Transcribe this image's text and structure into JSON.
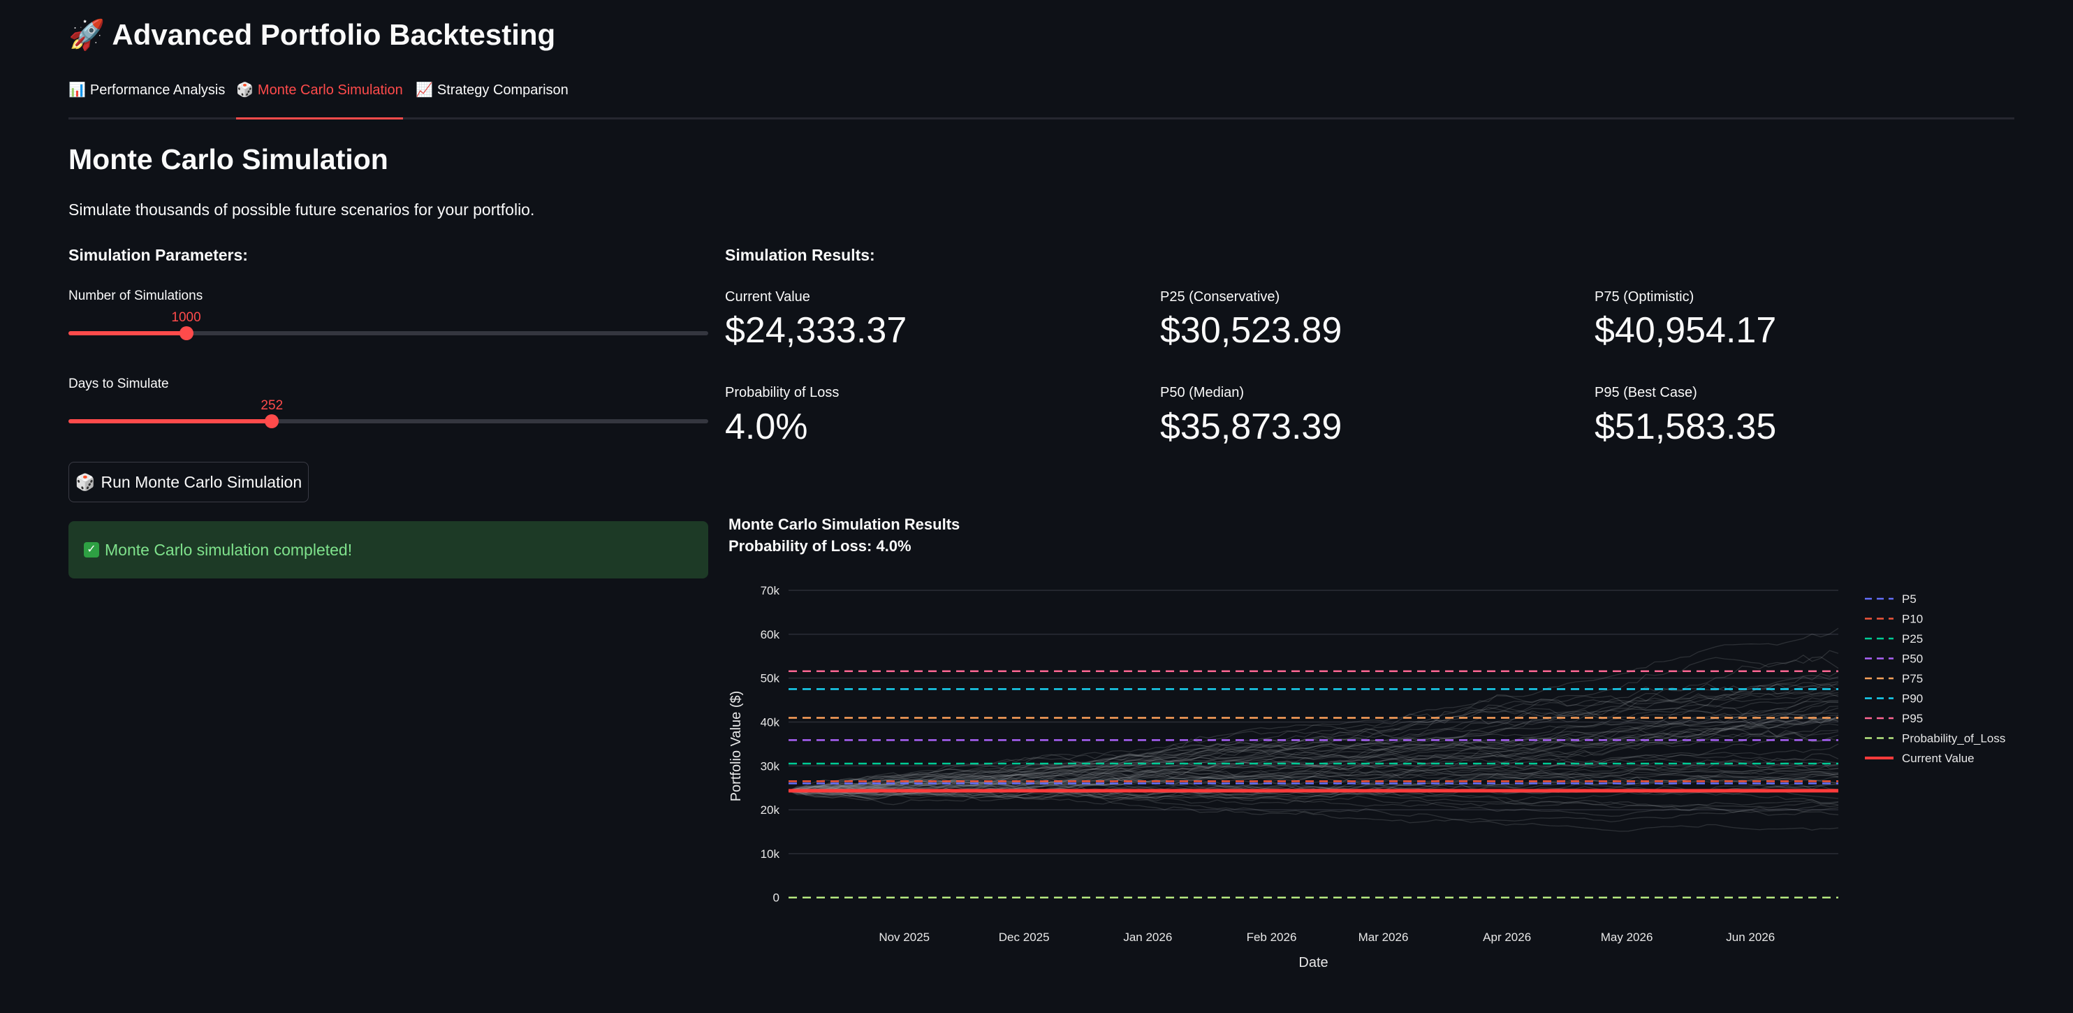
{
  "app": {
    "title": "Advanced Portfolio Backtesting"
  },
  "tabs": [
    {
      "label": "Performance Analysis",
      "icon": "bar-chart-icon",
      "active": false
    },
    {
      "label": "Monte Carlo Simulation",
      "icon": "dice-icon",
      "active": true
    },
    {
      "label": "Strategy Comparison",
      "icon": "trend-chart-icon",
      "active": false
    }
  ],
  "page": {
    "heading": "Monte Carlo Simulation",
    "description": "Simulate thousands of possible future scenarios for your portfolio."
  },
  "params": {
    "heading": "Simulation Parameters:",
    "sims_slider": {
      "label": "Number of Simulations",
      "value": "1000",
      "fill_fraction": 0.184
    },
    "days_slider": {
      "label": "Days to Simulate",
      "value": "252",
      "fill_fraction": 0.318
    },
    "run_button": "Run Monte Carlo Simulation",
    "success_message": "Monte Carlo simulation completed!"
  },
  "results": {
    "heading": "Simulation Results:",
    "metrics": [
      {
        "label": "Current Value",
        "value": "$24,333.37"
      },
      {
        "label": "P25 (Conservative)",
        "value": "$30,523.89"
      },
      {
        "label": "P75 (Optimistic)",
        "value": "$40,954.17"
      },
      {
        "label": "Probability of Loss",
        "value": "4.0%"
      },
      {
        "label": "P50 (Median)",
        "value": "$35,873.39"
      },
      {
        "label": "P95 (Best Case)",
        "value": "$51,583.35"
      }
    ]
  },
  "chart_data": {
    "type": "line",
    "title": "Monte Carlo Simulation Results",
    "subtitle": "Probability of Loss: 4.0%",
    "xlabel": "Date",
    "ylabel": "Portfolio Value ($)",
    "x_range": [
      "2025-10-03",
      "2026-06-23"
    ],
    "x_ticks": [
      {
        "label": "Nov 2025",
        "date": "2025-11-01"
      },
      {
        "label": "Dec 2025",
        "date": "2025-12-01"
      },
      {
        "label": "Jan 2026",
        "date": "2026-01-01"
      },
      {
        "label": "Feb 2026",
        "date": "2026-02-01"
      },
      {
        "label": "Mar 2026",
        "date": "2026-03-01"
      },
      {
        "label": "Apr 2026",
        "date": "2026-04-01"
      },
      {
        "label": "May 2026",
        "date": "2026-05-01"
      },
      {
        "label": "Jun 2026",
        "date": "2026-06-01"
      }
    ],
    "y_ticks": [
      {
        "label": "0",
        "value": 0
      },
      {
        "label": "10k",
        "value": 10000
      },
      {
        "label": "20k",
        "value": 20000
      },
      {
        "label": "30k",
        "value": 30000
      },
      {
        "label": "40k",
        "value": 40000
      },
      {
        "label": "50k",
        "value": 50000
      },
      {
        "label": "60k",
        "value": 60000
      },
      {
        "label": "70k",
        "value": 70000
      }
    ],
    "ylim": [
      -1000,
      70000
    ],
    "grid": true,
    "legend_position": "right",
    "start_value": 24333.37,
    "simulated_path_color": "#9aa0a6",
    "series": [
      {
        "name": "P5",
        "value": 26000,
        "color": "#636efa",
        "style": "dash"
      },
      {
        "name": "P10",
        "value": 26500,
        "color": "#ef553b",
        "style": "dash"
      },
      {
        "name": "P25",
        "value": 30523.89,
        "color": "#00cc96",
        "style": "dash"
      },
      {
        "name": "P50",
        "value": 35873.39,
        "color": "#ab63fa",
        "style": "dash"
      },
      {
        "name": "P75",
        "value": 40954.17,
        "color": "#ffa15a",
        "style": "dash"
      },
      {
        "name": "P90",
        "value": 47500,
        "color": "#19d3f3",
        "style": "dash"
      },
      {
        "name": "P95",
        "value": 51583.35,
        "color": "#ff6692",
        "style": "dash"
      },
      {
        "name": "Probability_of_Loss",
        "value": 0,
        "color": "#b6e880",
        "style": "dash"
      },
      {
        "name": "Current Value",
        "value": 24333.37,
        "color": "#ff3b3b",
        "style": "solid"
      }
    ]
  }
}
